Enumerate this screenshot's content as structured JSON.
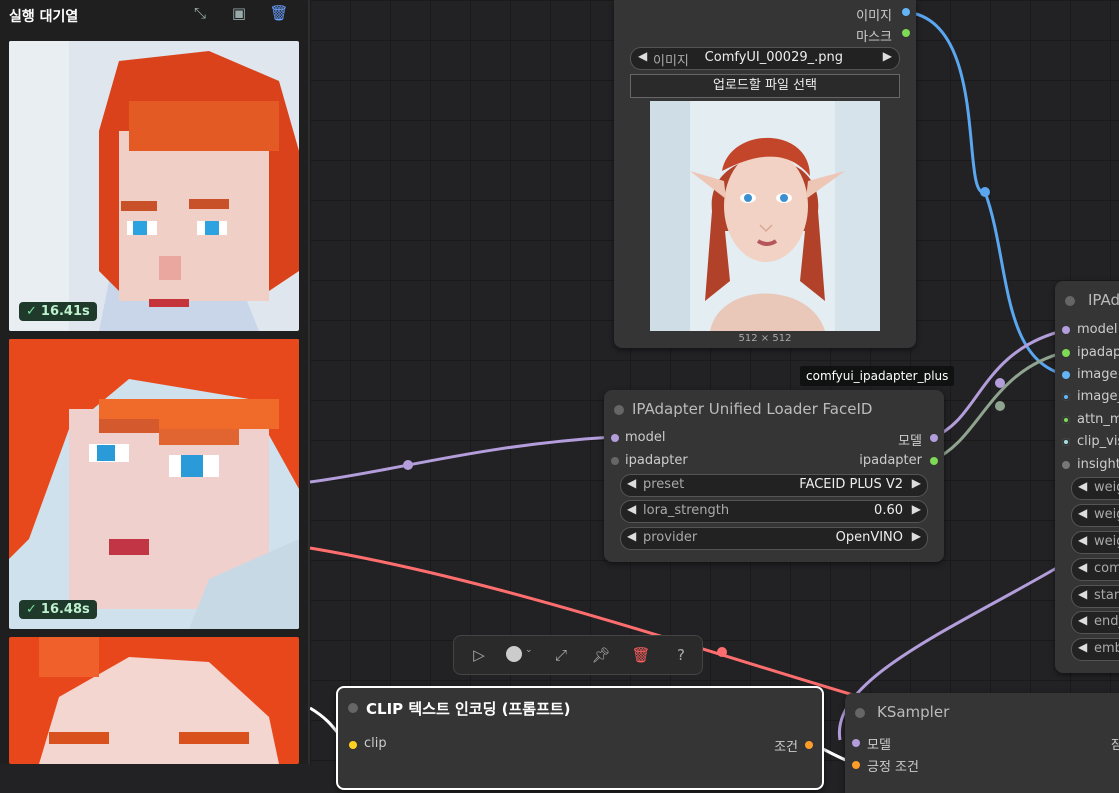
{
  "queue": {
    "title": "실행 대기열",
    "items": [
      {
        "time": "16.41s"
      },
      {
        "time": "16.48s"
      },
      {
        "time": ""
      }
    ]
  },
  "load_image_node": {
    "outputs": {
      "image": "이미지",
      "mask": "마스크"
    },
    "image_widget": {
      "label": "이미지",
      "value": "ComfyUI_00029_.png"
    },
    "upload_button": "업로드할 파일 선택",
    "image_size": "512 × 512"
  },
  "tooltip": "comfyui_ipadapter_plus",
  "faceid_loader": {
    "title": "IPAdapter Unified Loader FaceID",
    "inputs": {
      "model": "model",
      "ipadapter": "ipadapter"
    },
    "outputs": {
      "model": "모델",
      "ipadapter": "ipadapter"
    },
    "widgets": [
      {
        "label": "preset",
        "value": "FACEID PLUS V2"
      },
      {
        "label": "lora_strength",
        "value": "0.60"
      },
      {
        "label": "provider",
        "value": "OpenVINO"
      }
    ]
  },
  "ipadapter_apply": {
    "title": "IPAd",
    "inputs": [
      "model",
      "ipadapt",
      "image",
      "image_",
      "attn_ma",
      "clip_vis",
      "insightf"
    ],
    "widgets": [
      "weig",
      "weig",
      "weig",
      "com",
      "start",
      "end_",
      "emb"
    ]
  },
  "clip_node": {
    "title": "CLIP 텍스트 인코딩 (프롬프트)",
    "input": "clip",
    "output": "조건"
  },
  "ksampler": {
    "title": "KSampler",
    "inputs": [
      "모델",
      "긍정 조건"
    ],
    "output_partial": "잠"
  },
  "colors": {
    "model": "#b39ddb",
    "image": "#64b5f6",
    "ipadapter": "#7ed957",
    "clip": "#ffd21f",
    "conditioning": "#ff9c2a",
    "latent": "#ff6e6e"
  }
}
